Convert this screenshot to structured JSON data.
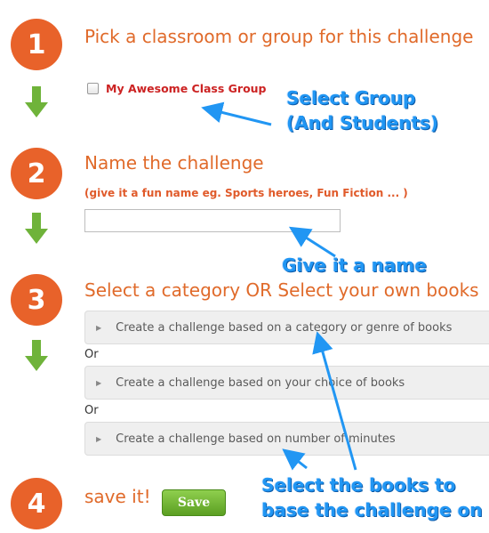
{
  "steps": [
    {
      "number": "1",
      "title": "Pick a classroom or group for this challenge"
    },
    {
      "number": "2",
      "title": "Name the challenge",
      "hint": "(give it a fun name eg. Sports heroes, Fun Fiction ... )"
    },
    {
      "number": "3",
      "title": "Select a category OR Select your own books"
    },
    {
      "number": "4",
      "title": "save it!"
    }
  ],
  "group": {
    "label": "My Awesome Class Group",
    "checked": false
  },
  "name_field": {
    "value": "",
    "placeholder": ""
  },
  "options": [
    {
      "label": "Create a challenge based on a category or genre of books"
    },
    {
      "label": "Create a challenge based on your choice of books"
    },
    {
      "label": "Create a challenge based on number of minutes"
    }
  ],
  "or_label": "Or",
  "save_label": "Save",
  "callouts": {
    "select_group_line1": "Select Group",
    "select_group_line2": "(And Students)",
    "give_name": "Give it a name",
    "select_books_line1": "Select the books to",
    "select_books_line2": "base the challenge on"
  },
  "colors": {
    "step_circle": "#e8622a",
    "heading": "#e06a2a",
    "arrow_green": "#6fb33a",
    "callout_blue": "#2196f3",
    "save_green": "#6fb33a"
  },
  "icons": {
    "down_arrow": "arrow-down-icon",
    "caret": "caret-right-icon",
    "checkbox": "checkbox-icon"
  }
}
